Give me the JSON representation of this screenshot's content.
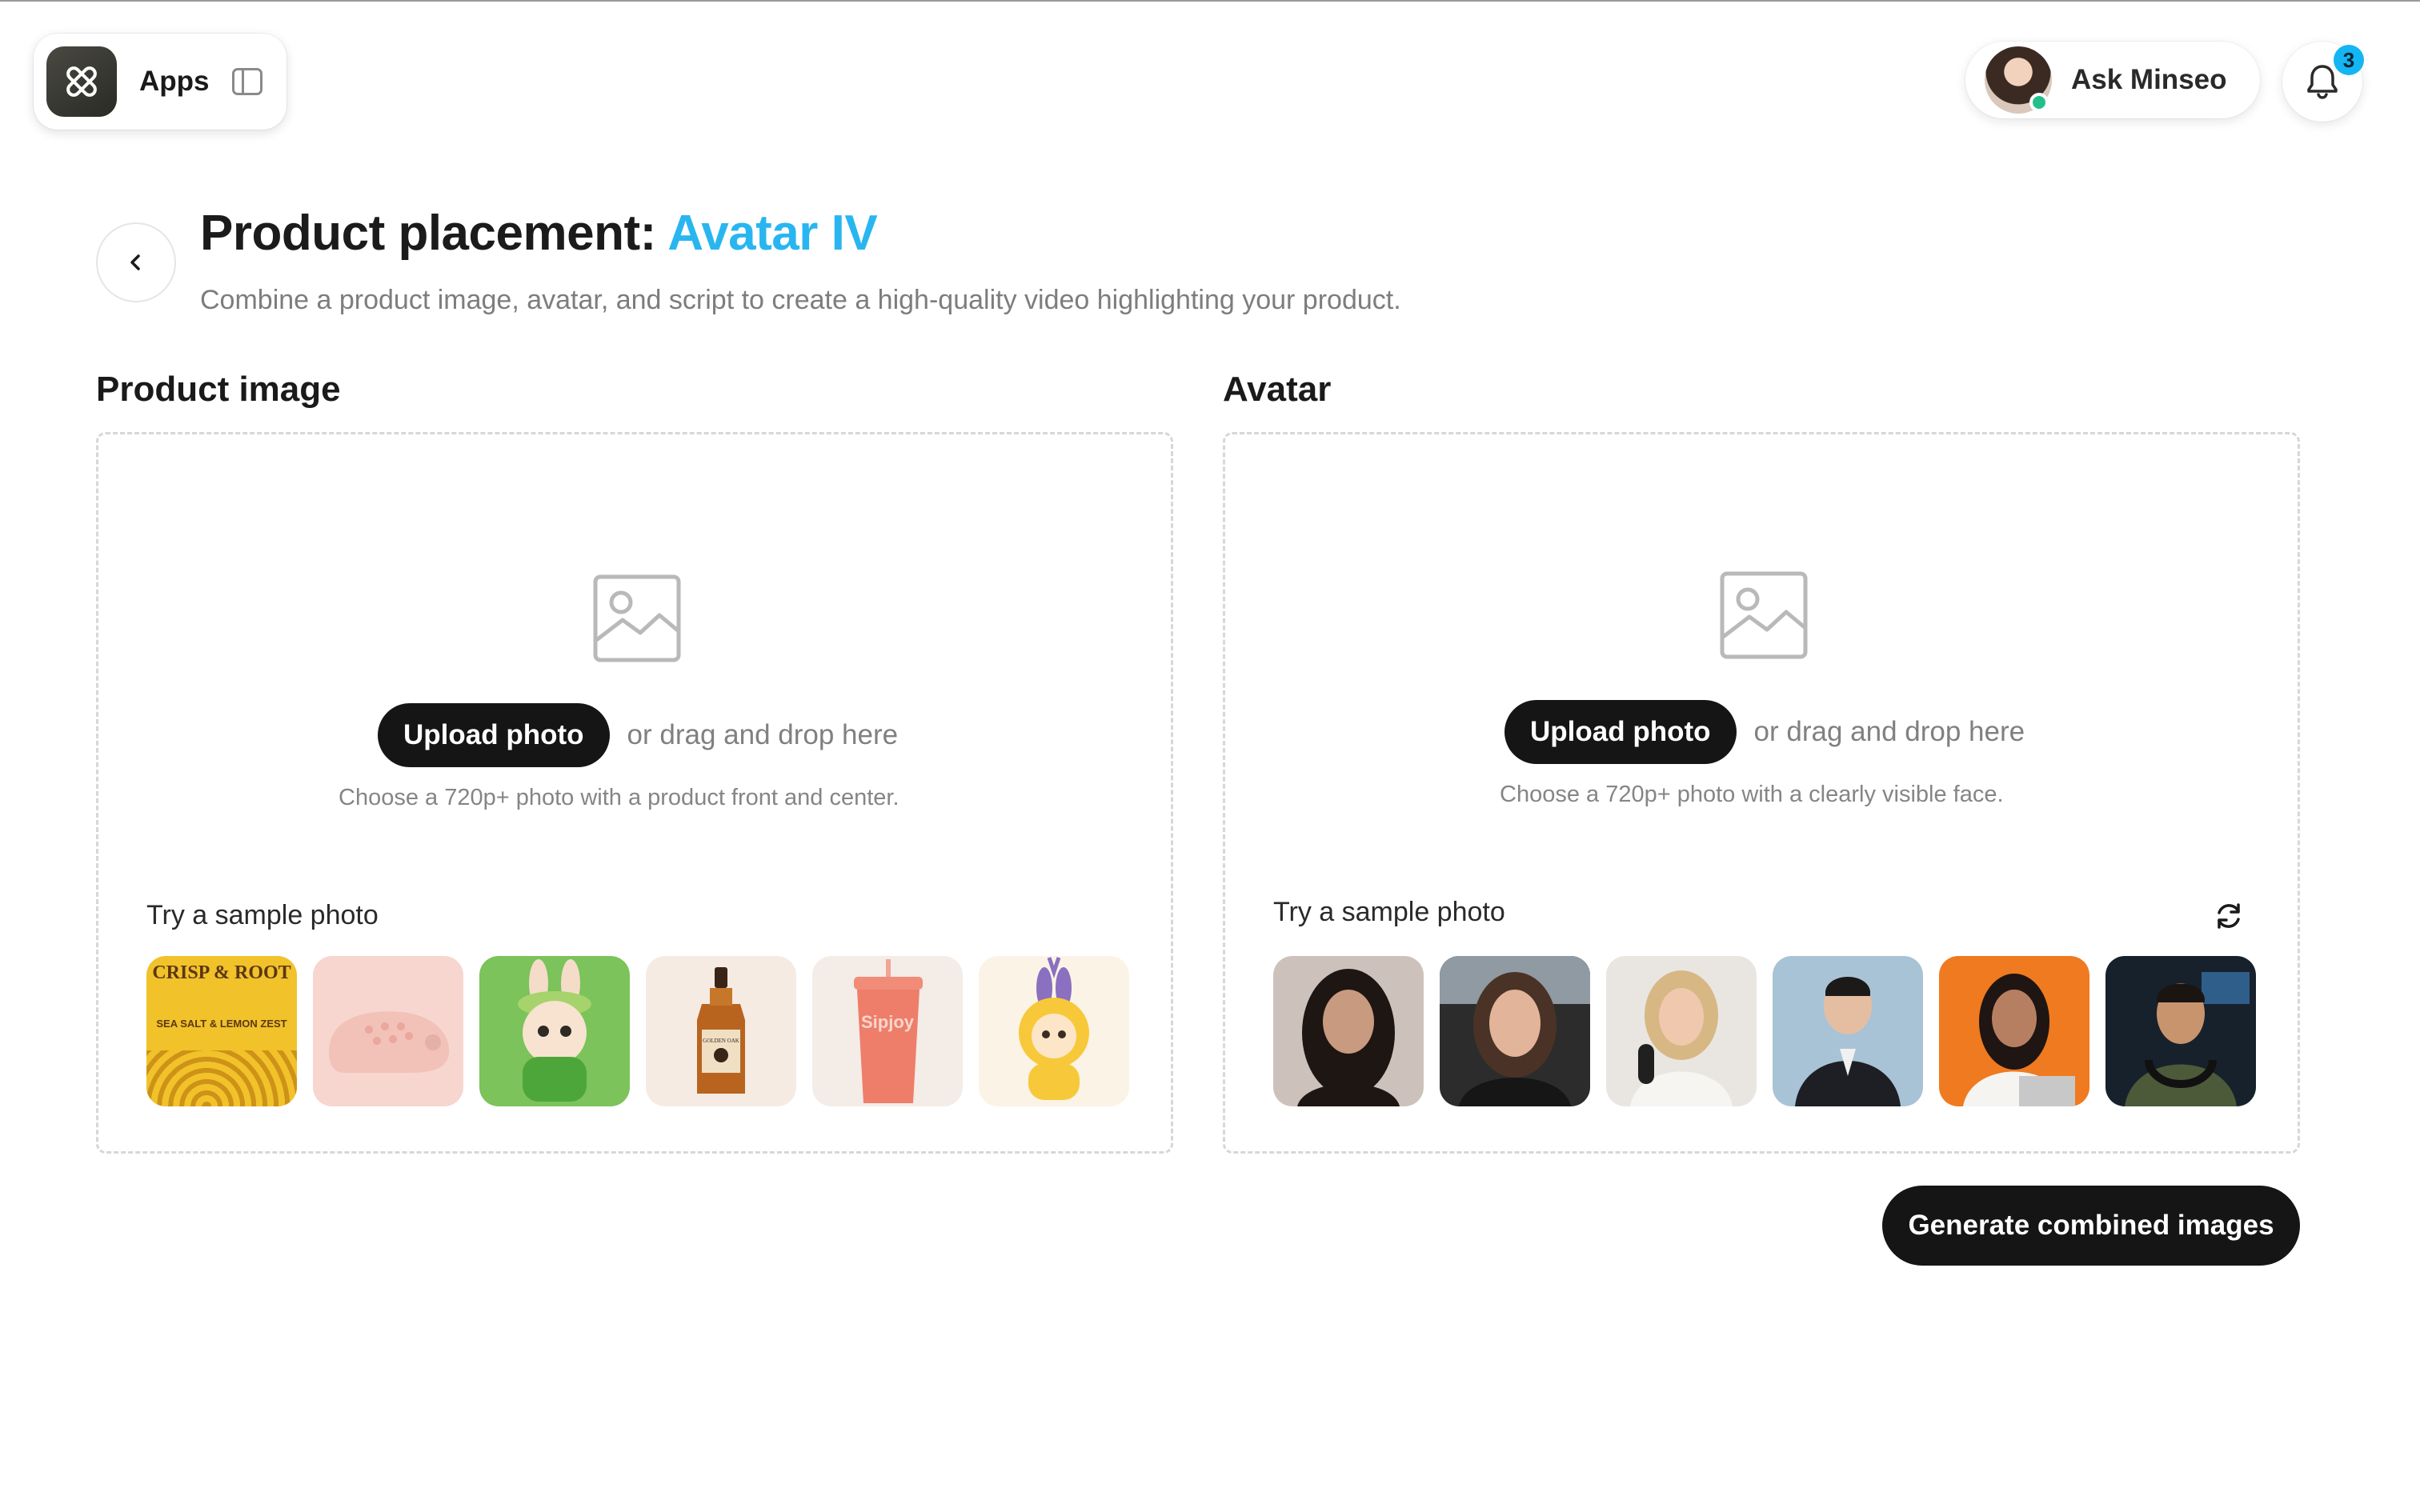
{
  "topbar": {
    "apps_label": "Apps",
    "user_label": "Ask Minseo",
    "notification_count": "3"
  },
  "header": {
    "title_prefix": "Product placement:",
    "title_accent": "Avatar IV",
    "subtitle": "Combine a product image, avatar, and script to create a high-quality video highlighting your product."
  },
  "product": {
    "heading": "Product image",
    "upload_label": "Upload photo",
    "drag_text": "or drag and drop here",
    "hint": "Choose a 720p+ photo with a product front and center.",
    "sample_label": "Try a sample photo",
    "samples": [
      {
        "name": "chips",
        "brand": "CRISP & ROOT",
        "subtext": "SEA SALT & LEMON ZEST"
      },
      {
        "name": "clog"
      },
      {
        "name": "plush-bunny-green"
      },
      {
        "name": "whiskey-bottle",
        "brand": "GOLDEN OAK"
      },
      {
        "name": "tumbler",
        "brand": "Sipjoy"
      },
      {
        "name": "plush-bunny-yellow"
      }
    ]
  },
  "avatar": {
    "heading": "Avatar",
    "upload_label": "Upload photo",
    "drag_text": "or drag and drop here",
    "hint": "Choose a 720p+ photo with a clearly visible face.",
    "sample_label": "Try a sample photo",
    "samples": [
      {
        "name": "woman-dark-hair"
      },
      {
        "name": "woman-car"
      },
      {
        "name": "woman-podcast"
      },
      {
        "name": "man-suit"
      },
      {
        "name": "woman-orange-bg"
      },
      {
        "name": "man-headphones"
      }
    ]
  },
  "actions": {
    "generate_label": "Generate combined images"
  },
  "colors": {
    "accent": "#29b6f0",
    "button_dark": "#151515",
    "badge": "#13b6f2",
    "online": "#21c08b"
  },
  "icons": [
    "apps-icon",
    "sidebar-toggle-icon",
    "bell-icon",
    "back-chevron-icon",
    "image-placeholder-icon",
    "refresh-icon"
  ]
}
